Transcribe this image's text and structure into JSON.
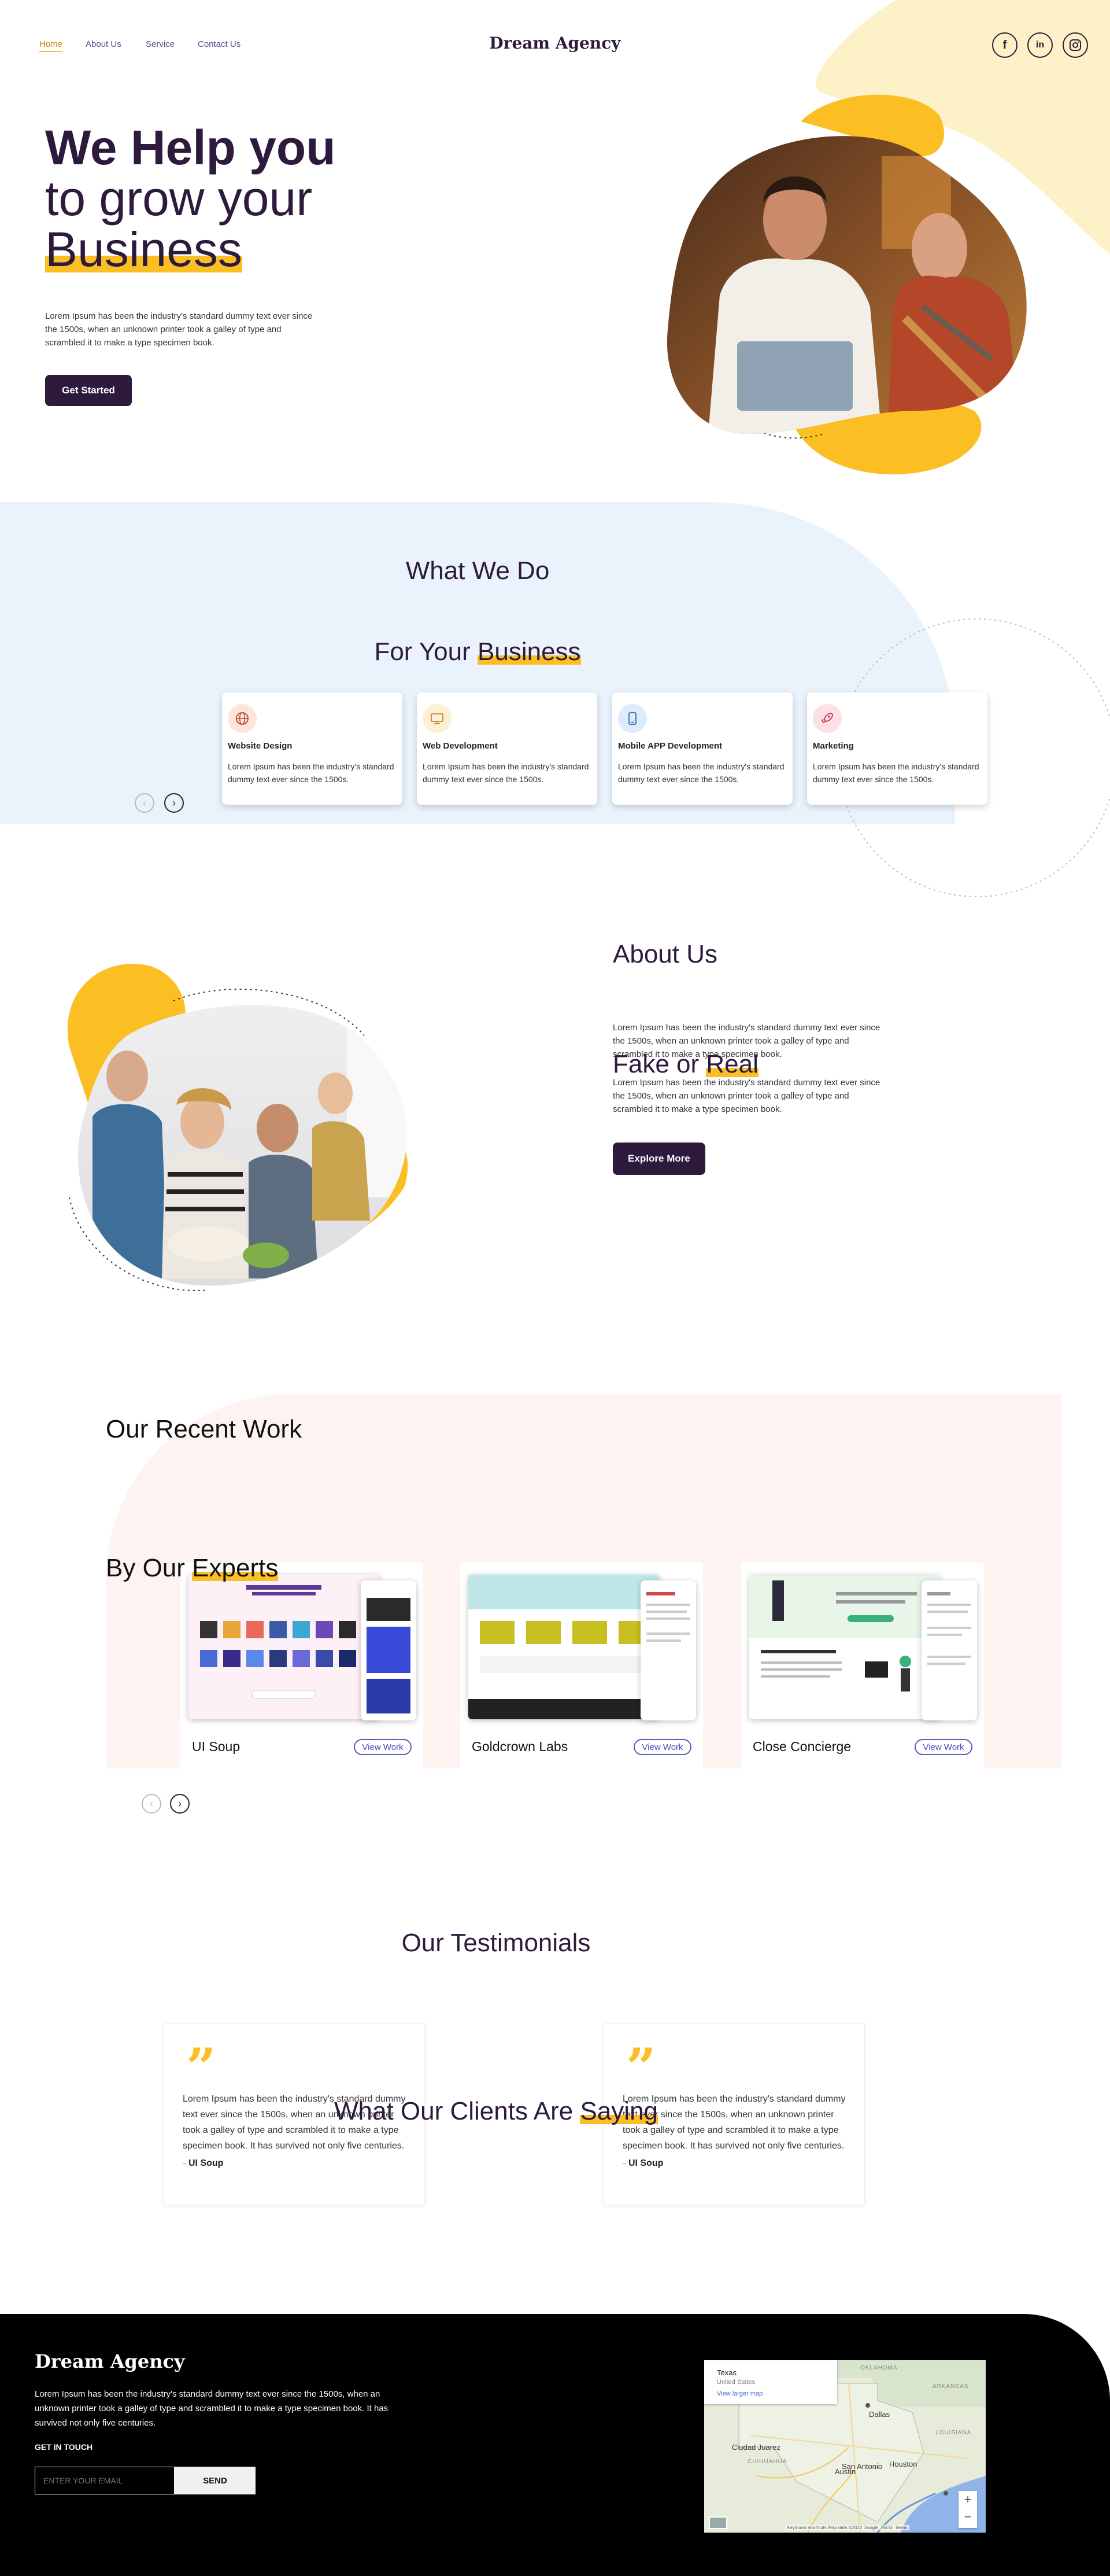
{
  "nav": {
    "links": [
      "Home",
      "About Us",
      "Service",
      "Contact Us"
    ],
    "brand": "Dream Agency",
    "social": [
      "facebook-icon",
      "linkedin-icon",
      "instagram-icon"
    ]
  },
  "hero": {
    "line1": "We Help you",
    "line2": "to grow your",
    "line3": "Business",
    "description": "Lorem Ipsum has been the industry's standard dummy text ever since the 1500s, when an unknown printer took a galley of type and scrambled it to make a type specimen book.",
    "cta": "Get Started"
  },
  "services": {
    "title": "What We Do",
    "subtitle_pre": "For Your ",
    "subtitle_hl": "Business",
    "cards": [
      {
        "icon": "globe-icon",
        "title": "Website Design",
        "text": "Lorem Ipsum has been the industry's standard dummy text ever since the 1500s."
      },
      {
        "icon": "monitor-icon",
        "title": "Web Development",
        "text": "Lorem Ipsum has been the industry's standard dummy text ever since the 1500s."
      },
      {
        "icon": "mobile-icon",
        "title": "Mobile APP Development",
        "text": "Lorem Ipsum has been the industry's standard dummy text ever since the 1500s."
      },
      {
        "icon": "rocket-icon",
        "title": "Marketing",
        "text": "Lorem Ipsum has been the industry's standard dummy text ever since the 1500s."
      }
    ]
  },
  "about": {
    "title": "About Us",
    "subtitle_pre": "Fake or ",
    "subtitle_hl": "Real",
    "p1": "Lorem Ipsum has been the industry's standard dummy text ever since the 1500s, when an unknown printer took a galley of type and scrambled it to make a type specimen book.",
    "p2": "Lorem Ipsum has been the industry's standard dummy text ever since the 1500s, when an unknown printer took a galley of type and scrambled it to make a type specimen book.",
    "cta": "Explore More"
  },
  "work": {
    "title": "Our Recent Work",
    "subtitle_pre": "By Our ",
    "subtitle_hl": "Experts",
    "items": [
      {
        "name": "UI Soup",
        "button": "View Work"
      },
      {
        "name": "Goldcrown Labs",
        "button": "View Work"
      },
      {
        "name": "Close Concierge",
        "button": "View Work"
      }
    ]
  },
  "testimonials": {
    "title": "Our Testimonials",
    "subtitle_pre": "What Our Clients Are ",
    "subtitle_hl": "Saying",
    "items": [
      {
        "text": "Lorem Ipsum has been the industry's standard dummy text ever since the 1500s, when an unknown printer took a galley of type and scrambled it to make a type specimen book. It has survived not only five centuries.",
        "author": "UI Soup"
      },
      {
        "text": "Lorem Ipsum has been the industry's standard dummy text ever since the 1500s, when an unknown printer took a galley of type and scrambled it to make a type specimen book. It has survived not only five centuries.",
        "author": "UI Soup"
      }
    ]
  },
  "footer": {
    "brand": "Dream Agency",
    "description": "Lorem Ipsum has been the industry's standard dummy text ever since the 1500s, when an unknown printer took a galley of type and scrambled it to make a type specimen book. It has survived not only five centuries.",
    "get_in_touch": "GET IN TOUCH",
    "email_placeholder": "ENTER YOUR EMAIL",
    "send": "SEND",
    "map": {
      "place": "Texas",
      "region": "United States",
      "link": "View larger map",
      "cities": [
        "Dallas",
        "Austin",
        "Houston",
        "San Antonio",
        "Ciudad Juarez",
        "OKLAHOMA",
        "ARKANSAS",
        "LOUISIANA",
        "CHIHUAHUA"
      ],
      "attribution": "Keyboard shortcuts   Map data ©2022 Google, INEGI   Terms"
    }
  },
  "colors": {
    "accent": "#fbbf24",
    "plum": "#2d1a3c",
    "services_bg": "#eaf3fc",
    "work_bg": "#fdf4f1",
    "footer_bg": "#000000"
  }
}
